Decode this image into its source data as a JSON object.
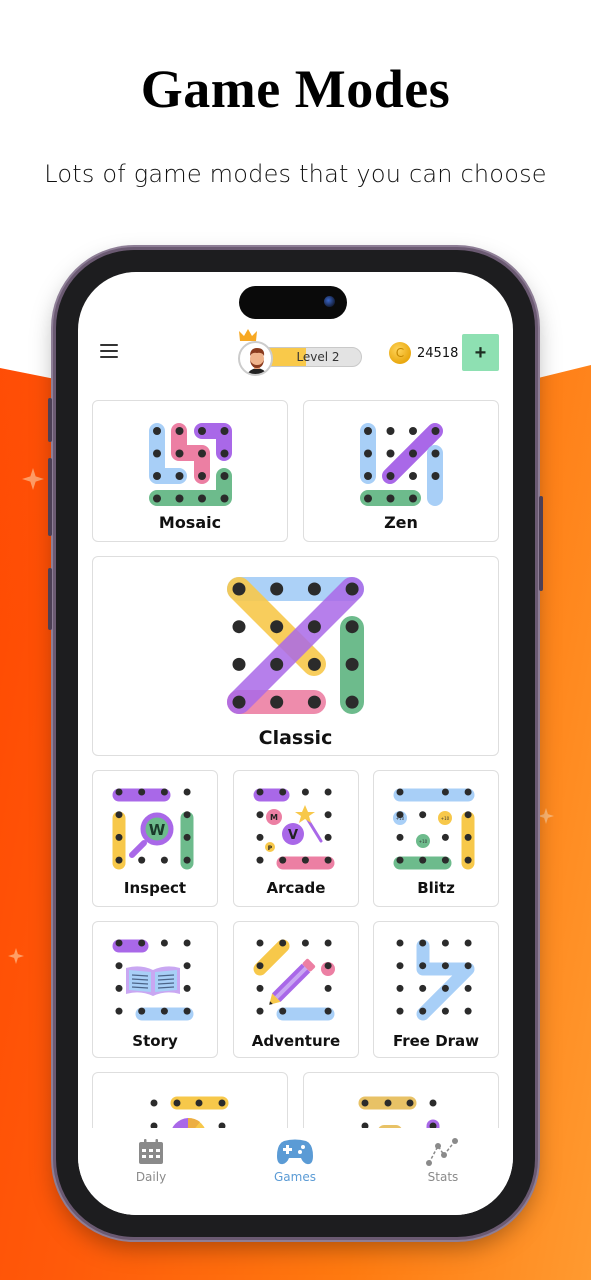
{
  "promo": {
    "headline": "Game Modes",
    "subline": "Lots of game modes that you can  choose"
  },
  "app": {
    "topbar": {
      "menu_icon": "hamburger-menu-icon",
      "level_label": "Level 2",
      "level_progress": 0.45,
      "coin_symbol": "C",
      "coins": "24518",
      "add_coins_label": "+"
    },
    "modes": [
      {
        "id": "mosaic",
        "label": "Mosaic"
      },
      {
        "id": "zen",
        "label": "Zen"
      },
      {
        "id": "classic",
        "label": "Classic"
      },
      {
        "id": "inspect",
        "label": "Inspect"
      },
      {
        "id": "arcade",
        "label": "Arcade"
      },
      {
        "id": "blitz",
        "label": "Blitz"
      },
      {
        "id": "story",
        "label": "Story"
      },
      {
        "id": "adventure",
        "label": "Adventure"
      },
      {
        "id": "free-draw",
        "label": "Free Draw"
      },
      {
        "id": "mode-10",
        "label": ""
      },
      {
        "id": "mode-11",
        "label": ""
      }
    ],
    "icon_text": {
      "inspect_letter": "W",
      "arcade_m": "M",
      "arcade_v": "V",
      "arcade_p": "P",
      "blitz_bonus": "+10"
    },
    "bottom_nav": [
      {
        "label": "Daily",
        "icon": "calendar-icon",
        "active": false
      },
      {
        "label": "Games",
        "icon": "gamepad-icon",
        "active": true
      },
      {
        "label": "Stats",
        "icon": "stats-line-icon",
        "active": false
      }
    ],
    "colors": {
      "blue": "#a8cff7",
      "pink": "#ec7fa3",
      "purple": "#a968e8",
      "green": "#6dbb8c",
      "yellow": "#f7c84a",
      "dot": "#2b2b2b",
      "nav_active": "#5b9bd5",
      "nav_inactive": "#8a8a8a",
      "add_button": "#8ee0b2",
      "accent_orange": "#ff5a0a"
    }
  }
}
